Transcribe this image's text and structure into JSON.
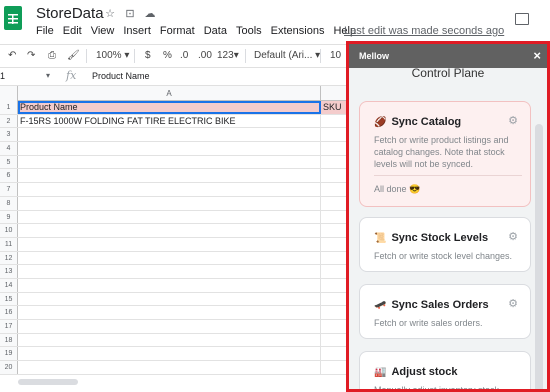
{
  "app": {
    "doc_title": "StoreData",
    "last_edit": "Last edit was made seconds ago"
  },
  "menu": [
    "File",
    "Edit",
    "View",
    "Insert",
    "Format",
    "Data",
    "Tools",
    "Extensions",
    "Help"
  ],
  "toolbar": {
    "zoom": "100%",
    "currency": "$",
    "percent": "%",
    "decrease_decimals": ".0",
    "increase_decimals": ".00",
    "more_formats": "123",
    "font": "Default (Ari...",
    "font_size": "10"
  },
  "formula_bar": {
    "cell_ref": "1",
    "value": "Product Name"
  },
  "sheet": {
    "column_a": "A",
    "rows": [
      {
        "num": "1",
        "a": "Product Name",
        "b": "SKU"
      },
      {
        "num": "2",
        "a": "F-15RS 1000W FOLDING FAT  TIRE ELECTRIC BIKE",
        "b": ""
      },
      {
        "num": "3",
        "a": "",
        "b": ""
      },
      {
        "num": "4",
        "a": "",
        "b": ""
      },
      {
        "num": "5",
        "a": "",
        "b": ""
      },
      {
        "num": "6",
        "a": "",
        "b": ""
      },
      {
        "num": "7",
        "a": "",
        "b": ""
      },
      {
        "num": "8",
        "a": "",
        "b": ""
      },
      {
        "num": "9",
        "a": "",
        "b": ""
      },
      {
        "num": "10",
        "a": "",
        "b": ""
      },
      {
        "num": "11",
        "a": "",
        "b": ""
      },
      {
        "num": "12",
        "a": "",
        "b": ""
      },
      {
        "num": "13",
        "a": "",
        "b": ""
      },
      {
        "num": "14",
        "a": "",
        "b": ""
      },
      {
        "num": "15",
        "a": "",
        "b": ""
      },
      {
        "num": "16",
        "a": "",
        "b": ""
      },
      {
        "num": "17",
        "a": "",
        "b": ""
      },
      {
        "num": "18",
        "a": "",
        "b": ""
      },
      {
        "num": "19",
        "a": "",
        "b": ""
      },
      {
        "num": "20",
        "a": "",
        "b": ""
      }
    ]
  },
  "panel": {
    "header": "Mellow",
    "close": "×",
    "title": "Control Plane",
    "cards": [
      {
        "icon": "🏈",
        "title": "Sync Catalog",
        "desc": "Fetch or write product listings and catalog changes. Note that stock levels will not be synced.",
        "status": "All done 😎"
      },
      {
        "icon": "📜",
        "title": "Sync Stock Levels",
        "desc": "Fetch or write stock level changes."
      },
      {
        "icon": "🛹",
        "title": "Sync Sales Orders",
        "desc": "Fetch or write sales orders."
      },
      {
        "icon": "🏭",
        "title": "Adjust stock",
        "desc": "Manually adjust inventory stock"
      }
    ]
  },
  "colors": {
    "header_fill": "#f4cccc",
    "panel_border": "#e01b24",
    "panel_header": "#616161",
    "selection": "#1a73e8"
  }
}
